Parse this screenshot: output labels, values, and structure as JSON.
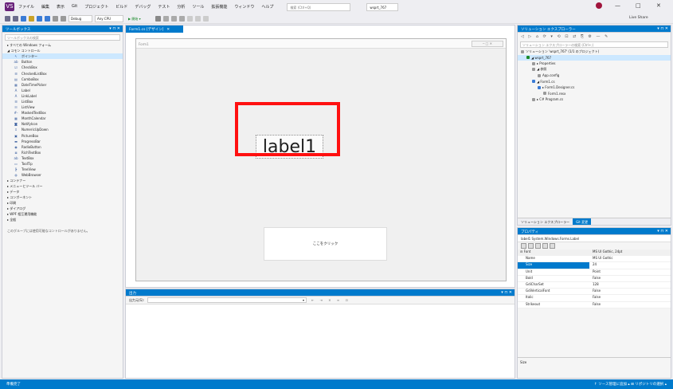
{
  "menubar": {
    "logo": "VS",
    "items": [
      "ファイル",
      "編集",
      "表示",
      "Git",
      "プロジェクト",
      "ビルド",
      "デバッグ",
      "テスト",
      "分析",
      "ツール",
      "拡張機能",
      "ウィンドウ",
      "ヘルプ"
    ],
    "search_placeholder": "検索 (Ctrl+Q)",
    "solution_name": "wsprt_767",
    "minimize": "—",
    "maximize": "□",
    "close": "✕",
    "liveshare": "Live Share"
  },
  "toolbar": {
    "config": "Debug",
    "platform": "Any CPU",
    "start": "▶ 開始 ▾"
  },
  "toolbox": {
    "title": "ツールボックス",
    "search_placeholder": "ツールボックスの検索",
    "sections": [
      {
        "label": "▸ すべての Windows フォーム",
        "items": []
      },
      {
        "label": "◢ コモン コントロール",
        "items": [
          {
            "icon": "pointer",
            "glyph": "↖",
            "label": "ポインター",
            "selected": true
          },
          {
            "icon": "button",
            "glyph": "ab",
            "label": "Button"
          },
          {
            "icon": "checkbox",
            "glyph": "☑",
            "label": "CheckBox"
          },
          {
            "icon": "checkedlistbox",
            "glyph": "☰",
            "label": "CheckedListBox"
          },
          {
            "icon": "combobox",
            "glyph": "▤",
            "label": "ComboBox"
          },
          {
            "icon": "datetimepicker",
            "glyph": "▦",
            "label": "DateTimePicker"
          },
          {
            "icon": "label",
            "glyph": "A",
            "label": "Label"
          },
          {
            "icon": "linklabel",
            "glyph": "A",
            "label": "LinkLabel"
          },
          {
            "icon": "listbox",
            "glyph": "☰",
            "label": "ListBox"
          },
          {
            "icon": "listview",
            "glyph": "☷",
            "label": "ListView"
          },
          {
            "icon": "maskedtextbox",
            "glyph": "#-",
            "label": "MaskedTextBox"
          },
          {
            "icon": "monthcalendar",
            "glyph": "▦",
            "label": "MonthCalendar"
          },
          {
            "icon": "notifyicon",
            "glyph": "◙",
            "label": "NotifyIcon"
          },
          {
            "icon": "numericupdown",
            "glyph": "⇕",
            "label": "NumericUpDown"
          },
          {
            "icon": "picturebox",
            "glyph": "▣",
            "label": "PictureBox"
          },
          {
            "icon": "progressbar",
            "glyph": "▬",
            "label": "ProgressBar"
          },
          {
            "icon": "radiobutton",
            "glyph": "◉",
            "label": "RadioButton"
          },
          {
            "icon": "richtextbox",
            "glyph": "≣",
            "label": "RichTextBox"
          },
          {
            "icon": "textbox",
            "glyph": "ab",
            "label": "TextBox"
          },
          {
            "icon": "tooltip",
            "glyph": "▭",
            "label": "ToolTip"
          },
          {
            "icon": "treeview",
            "glyph": "┣",
            "label": "TreeView"
          },
          {
            "icon": "webbrowser",
            "glyph": "◍",
            "label": "WebBrowser"
          }
        ]
      },
      {
        "label": "▸ コンテナー",
        "items": []
      },
      {
        "label": "▸ メニューとツール バー",
        "items": []
      },
      {
        "label": "▸ データ",
        "items": []
      },
      {
        "label": "▸ コンポーネント",
        "items": []
      },
      {
        "label": "▸ 印刷",
        "items": []
      },
      {
        "label": "▸ ダイアログ",
        "items": []
      },
      {
        "label": "▸ WPF 相互運用機能",
        "items": []
      },
      {
        "label": "▸ 全般",
        "items": []
      }
    ],
    "footer": "このグループには使用可能なコントロールがありません。"
  },
  "designer": {
    "tab": "Form1.cs [デザイン]",
    "form_title": "Form1",
    "window_buttons": "─ □ ✕",
    "label1": "label1",
    "button1": "ここをクリック"
  },
  "output": {
    "title": "出力",
    "source_label": "出力元(S):"
  },
  "solution_explorer": {
    "title": "ソリューション エクスプローラー",
    "toolbar": "◁ ▷ ⌂ ⟳ ▾ ⟲ ⊡ ⇄ ⎘ ⚙ — ✎",
    "search_placeholder": "ソリューション エクスプローラーの検索 (Ctrl+;)",
    "tree": [
      {
        "indent": 0,
        "icon": "solution",
        "text": "ソリューション 'wsprt_767' (1/1 のプロジェクト)"
      },
      {
        "indent": 1,
        "icon": "project",
        "text": "◢ wsprt_767",
        "selected": true
      },
      {
        "indent": 2,
        "icon": "properties",
        "text": "▸ Properties"
      },
      {
        "indent": 2,
        "icon": "references",
        "text": "◢ 参照"
      },
      {
        "indent": 3,
        "icon": "config",
        "text": "App.config"
      },
      {
        "indent": 2,
        "icon": "form",
        "text": "◢ Form1.cs"
      },
      {
        "indent": 3,
        "icon": "form",
        "text": "▸ Form1.Designer.cs"
      },
      {
        "indent": 4,
        "icon": "resx",
        "text": "Form1.resx"
      },
      {
        "indent": 2,
        "icon": "csfile",
        "text": "▸ C# Program.cs"
      }
    ],
    "tabs": [
      "ソリューション エクスプローラー",
      "Git 変更"
    ]
  },
  "properties": {
    "title": "プロパティ",
    "object": "label1 System.Windows.Forms.Label",
    "rows": [
      {
        "name": "⊟ Font",
        "value": "MS UI Gothic, 24pt",
        "cat": true
      },
      {
        "name": "Name",
        "value": "MS UI Gothic"
      },
      {
        "name": "Size",
        "value": "24",
        "selected": true
      },
      {
        "name": "Unit",
        "value": "Point"
      },
      {
        "name": "Bold",
        "value": "False"
      },
      {
        "name": "GdiCharSet",
        "value": "128"
      },
      {
        "name": "GdiVerticalFont",
        "value": "False"
      },
      {
        "name": "Italic",
        "value": "False"
      },
      {
        "name": "Strikeout",
        "value": "False"
      }
    ],
    "description": "Size"
  },
  "statusbar": {
    "left": "準備完了",
    "right": "↑ ソース管理に追加 ▴   ⊞ リポジトリの選択 ▴"
  }
}
